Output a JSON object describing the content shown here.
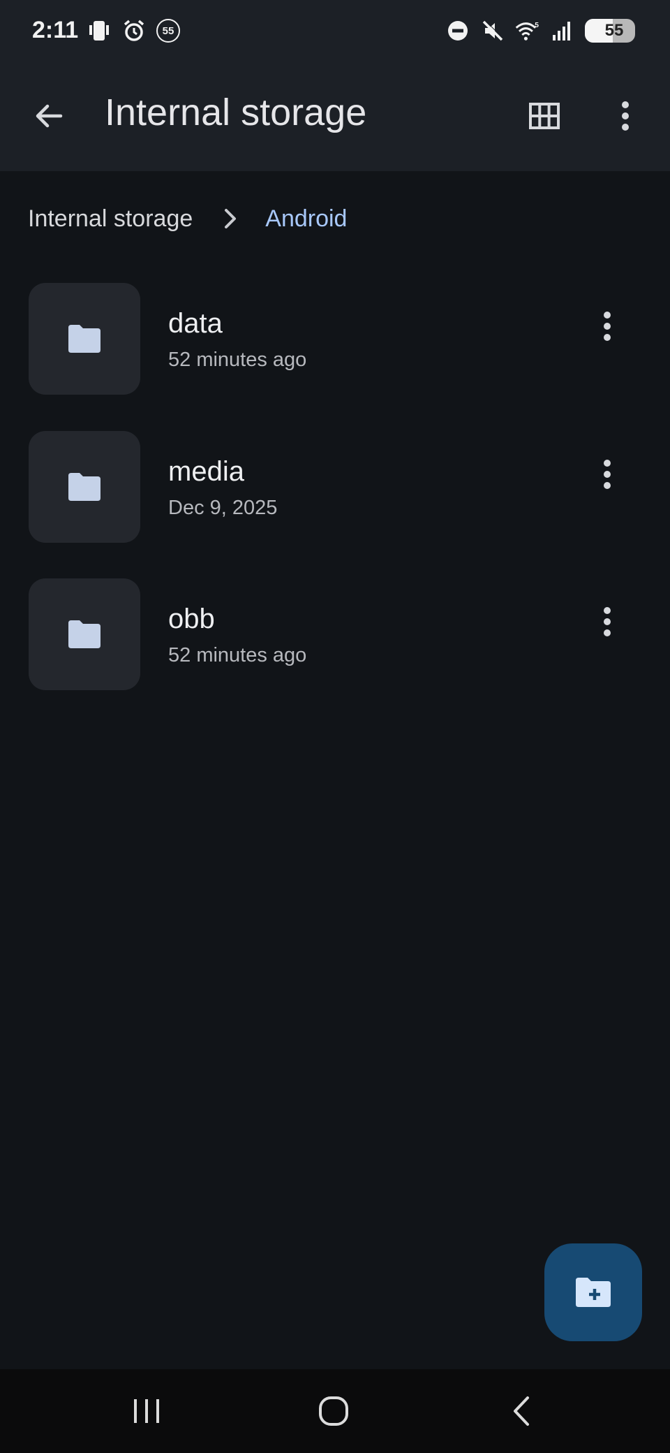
{
  "status_bar": {
    "time": "2:11",
    "notification_badge": "55",
    "battery_level": "55",
    "battery_fraction": 0.55,
    "wifi_label": "5"
  },
  "app_bar": {
    "title": "Internal storage"
  },
  "breadcrumb": {
    "root": "Internal storage",
    "current": "Android"
  },
  "files": [
    {
      "name": "data",
      "date": "52 minutes ago"
    },
    {
      "name": "media",
      "date": "Dec 9, 2025"
    },
    {
      "name": "obb",
      "date": "52 minutes ago"
    }
  ],
  "colors": {
    "background": "#111418",
    "app_bar": "#1c2026",
    "accent": "#a8c8fa",
    "folder_icon": "#c5d2e8",
    "fab": "#174a73",
    "tile": "#24272d"
  },
  "icons": {
    "back": "arrow-left-icon",
    "view_toggle": "grid-view-icon",
    "overflow": "more-vert-icon",
    "folder": "folder-icon",
    "fab": "create-folder-icon"
  }
}
